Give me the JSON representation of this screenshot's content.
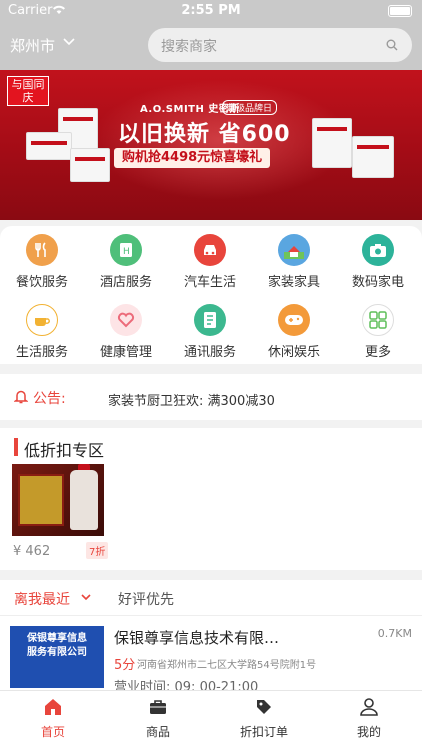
{
  "status_bar": {
    "carrier": "Carrier",
    "time": "2:55 PM"
  },
  "header": {
    "city": "郑州市",
    "search_placeholder": "搜索商家"
  },
  "banner": {
    "logo_text": "与国同庆",
    "brand": "A.O.SMITH 史密斯",
    "tag": "超级品牌日",
    "headline": "以旧换新 省600",
    "subline": "购机抢4498元惊喜壕礼",
    "slide_count": 3,
    "active_slide": 0
  },
  "categories": [
    {
      "label": "餐饮服务",
      "icon": "restaurant-icon",
      "color": "#f0a04b"
    },
    {
      "label": "酒店服务",
      "icon": "hotel-icon",
      "color": "#4fbf7a"
    },
    {
      "label": "汽车生活",
      "icon": "car-icon",
      "color": "#e8453c"
    },
    {
      "label": "家装家具",
      "icon": "house-icon",
      "color": "#5aa6e0"
    },
    {
      "label": "数码家电",
      "icon": "camera-icon",
      "color": "#2db39a"
    },
    {
      "label": "生活服务",
      "icon": "coffee-icon",
      "color": "#f2b233"
    },
    {
      "label": "健康管理",
      "icon": "heart-icon",
      "color": "#ec6b7a"
    },
    {
      "label": "通讯服务",
      "icon": "contacts-icon",
      "color": "#3cb88f"
    },
    {
      "label": "休闲娱乐",
      "icon": "gamepad-icon",
      "color": "#f39a3a"
    },
    {
      "label": "更多",
      "icon": "grid-icon",
      "color": "#5fbf5a"
    }
  ],
  "notice": {
    "label": "公告:",
    "text": "家装节厨卫狂欢: 满300减30"
  },
  "discount_zone": {
    "title": "低折扣专区",
    "items": [
      {
        "price": "¥ 462",
        "discount": "7折"
      }
    ]
  },
  "sort_bar": {
    "primary": "离我最近",
    "secondary": "好评优先"
  },
  "shops": [
    {
      "name": "保银尊享信息技术有限…",
      "distance": "0.7KM",
      "score": "5分",
      "address": "河南省郑州市二七区大学路54号院附1号",
      "hours": "营业时间: 09: 00-21:00",
      "thumb_text_1": "保银尊享信息",
      "thumb_text_2": "服务有限公司"
    }
  ],
  "tabbar": [
    {
      "label": "首页",
      "icon": "home-icon",
      "active": true
    },
    {
      "label": "商品",
      "icon": "briefcase-icon",
      "active": false
    },
    {
      "label": "折扣订单",
      "icon": "tag-icon",
      "active": false
    },
    {
      "label": "我的",
      "icon": "user-icon",
      "active": false
    }
  ],
  "colors": {
    "accent": "#e8453c",
    "banner": "#c1121c",
    "header": "#c9c9c9"
  }
}
